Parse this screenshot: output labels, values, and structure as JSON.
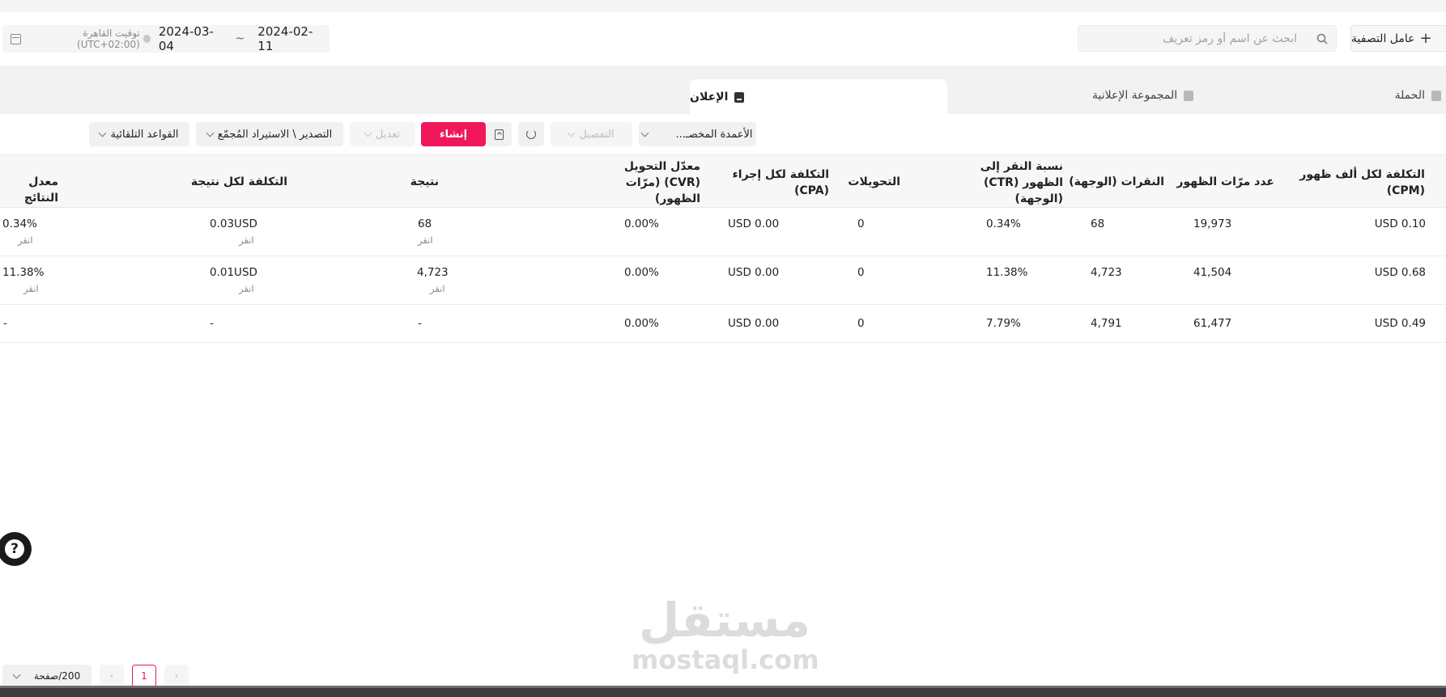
{
  "header": {
    "filter_label": "عامل التصفية",
    "search_placeholder": "ابحث عن اسم أو رمز تعريف",
    "date_start": "2024-02-11",
    "date_sep": "~",
    "date_end": "2024-03-04",
    "timezone": "توقيت القاهرة (UTC+02:00)"
  },
  "tabs": {
    "campaign": "الحملة",
    "ad_group": "المجموعة الإعلانية",
    "ad": "الإعلان"
  },
  "toolbar": {
    "custom_columns": "الأعمدة المخصـ...",
    "breakdown": "التفصيل",
    "create": "إنشاء",
    "edit": "تعديل",
    "export_import": "التصدير \\ الاستيراد المُجمّع",
    "auto_rules": "القواعد التلقائية"
  },
  "table": {
    "headers": {
      "cpm": [
        "التكلفة لكل ألف ظهور",
        "(CPM)"
      ],
      "impressions": "عدد مرّات الظهور",
      "clicks": "النقرات (الوجهة)",
      "ctr": [
        "نسبة النقر إلى",
        "الظهور (CTR)",
        "(الوجهة)"
      ],
      "conversions": "التحويلات",
      "cpa": [
        "التكلفة لكل إجراء",
        "(CPA)"
      ],
      "cvr": [
        "معدّل التحويل",
        "(CVR) (مرّات",
        "الظهور)"
      ],
      "result": "نتيجة",
      "cost_per_result": "التكلفة لكل نتيجة",
      "result_rate": "معدل النتائج"
    },
    "rows": [
      {
        "cpm": "USD 0.10",
        "impressions": "19,973",
        "clicks": "68",
        "ctr": "0.34%",
        "conversions": "0",
        "cpa": "USD 0.00",
        "cvr": "0.00%",
        "result": "68",
        "result_sub": "انقر",
        "cost_per_result": "0.03USD",
        "cost_sub": "انقر",
        "result_rate": "0.34%",
        "rate_sub": "انقر"
      },
      {
        "cpm": "USD 0.68",
        "impressions": "41,504",
        "clicks": "4,723",
        "ctr": "11.38%",
        "conversions": "0",
        "cpa": "USD 0.00",
        "cvr": "0.00%",
        "result": "4,723",
        "result_sub": "انقر",
        "cost_per_result": "0.01USD",
        "cost_sub": "انقر",
        "result_rate": "11.38%",
        "rate_sub": "انقر"
      },
      {
        "cpm": "USD 0.49",
        "impressions": "61,477",
        "clicks": "4,791",
        "ctr": "7.79%",
        "conversions": "0",
        "cpa": "USD 0.00",
        "cvr": "0.00%",
        "result": "-",
        "cost_per_result": "-",
        "result_rate": "-"
      }
    ]
  },
  "pagination": {
    "page_size": "200/صفحة",
    "current_page": "1",
    "prev": "‹",
    "next": "›"
  },
  "help_icon": "?",
  "watermark": {
    "arabic": "مستقل",
    "latin": "mostaql.com"
  },
  "colors": {
    "primary": "#f0185a"
  }
}
